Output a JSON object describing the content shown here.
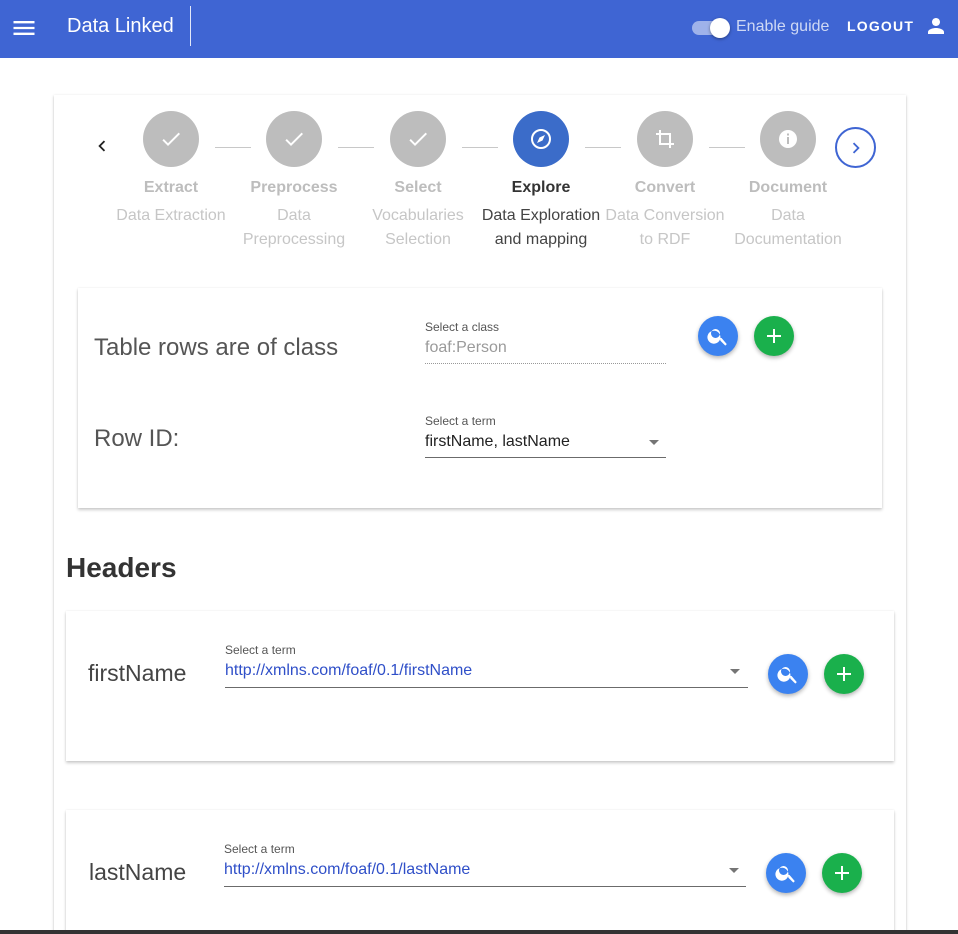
{
  "app": {
    "title": "Data Linked",
    "guide_label": "Enable guide",
    "guide_enabled": true,
    "logout_label": "LOGOUT"
  },
  "colors": {
    "primary": "#3f65d3",
    "active_step": "#3b6cc9",
    "search_fab": "#3b82f0",
    "add_fab": "#1ab04c",
    "link": "#2f4fc8"
  },
  "stepper": {
    "steps": [
      {
        "name": "Extract",
        "desc_line1": "Data Extraction",
        "desc_line2": "",
        "icon": "check-icon",
        "state": "done"
      },
      {
        "name": "Preprocess",
        "desc_line1": "Data",
        "desc_line2": "Preprocessing",
        "icon": "check-icon",
        "state": "done"
      },
      {
        "name": "Select",
        "desc_line1": "Vocabularies",
        "desc_line2": "Selection",
        "icon": "check-icon",
        "state": "done"
      },
      {
        "name": "Explore",
        "desc_line1": "Data Exploration",
        "desc_line2": "and mapping",
        "icon": "compass-icon",
        "state": "active"
      },
      {
        "name": "Convert",
        "desc_line1": "Data Conversion",
        "desc_line2": "to RDF",
        "icon": "crop-icon",
        "state": "pending"
      },
      {
        "name": "Document",
        "desc_line1": "Data",
        "desc_line2": "Documentation",
        "icon": "info-icon",
        "state": "pending"
      }
    ]
  },
  "class_section": {
    "label": "Table rows are of class",
    "caption": "Select a class",
    "value": "foaf:Person",
    "row_id_label": "Row ID:",
    "row_id_caption": "Select a term",
    "row_id_value": "firstName, lastName"
  },
  "headers": {
    "title": "Headers",
    "items": [
      {
        "name": "firstName",
        "caption": "Select a term",
        "value": "http://xmlns.com/foaf/0.1/firstName"
      },
      {
        "name": "lastName",
        "caption": "Select a term",
        "value": "http://xmlns.com/foaf/0.1/lastName"
      }
    ]
  }
}
